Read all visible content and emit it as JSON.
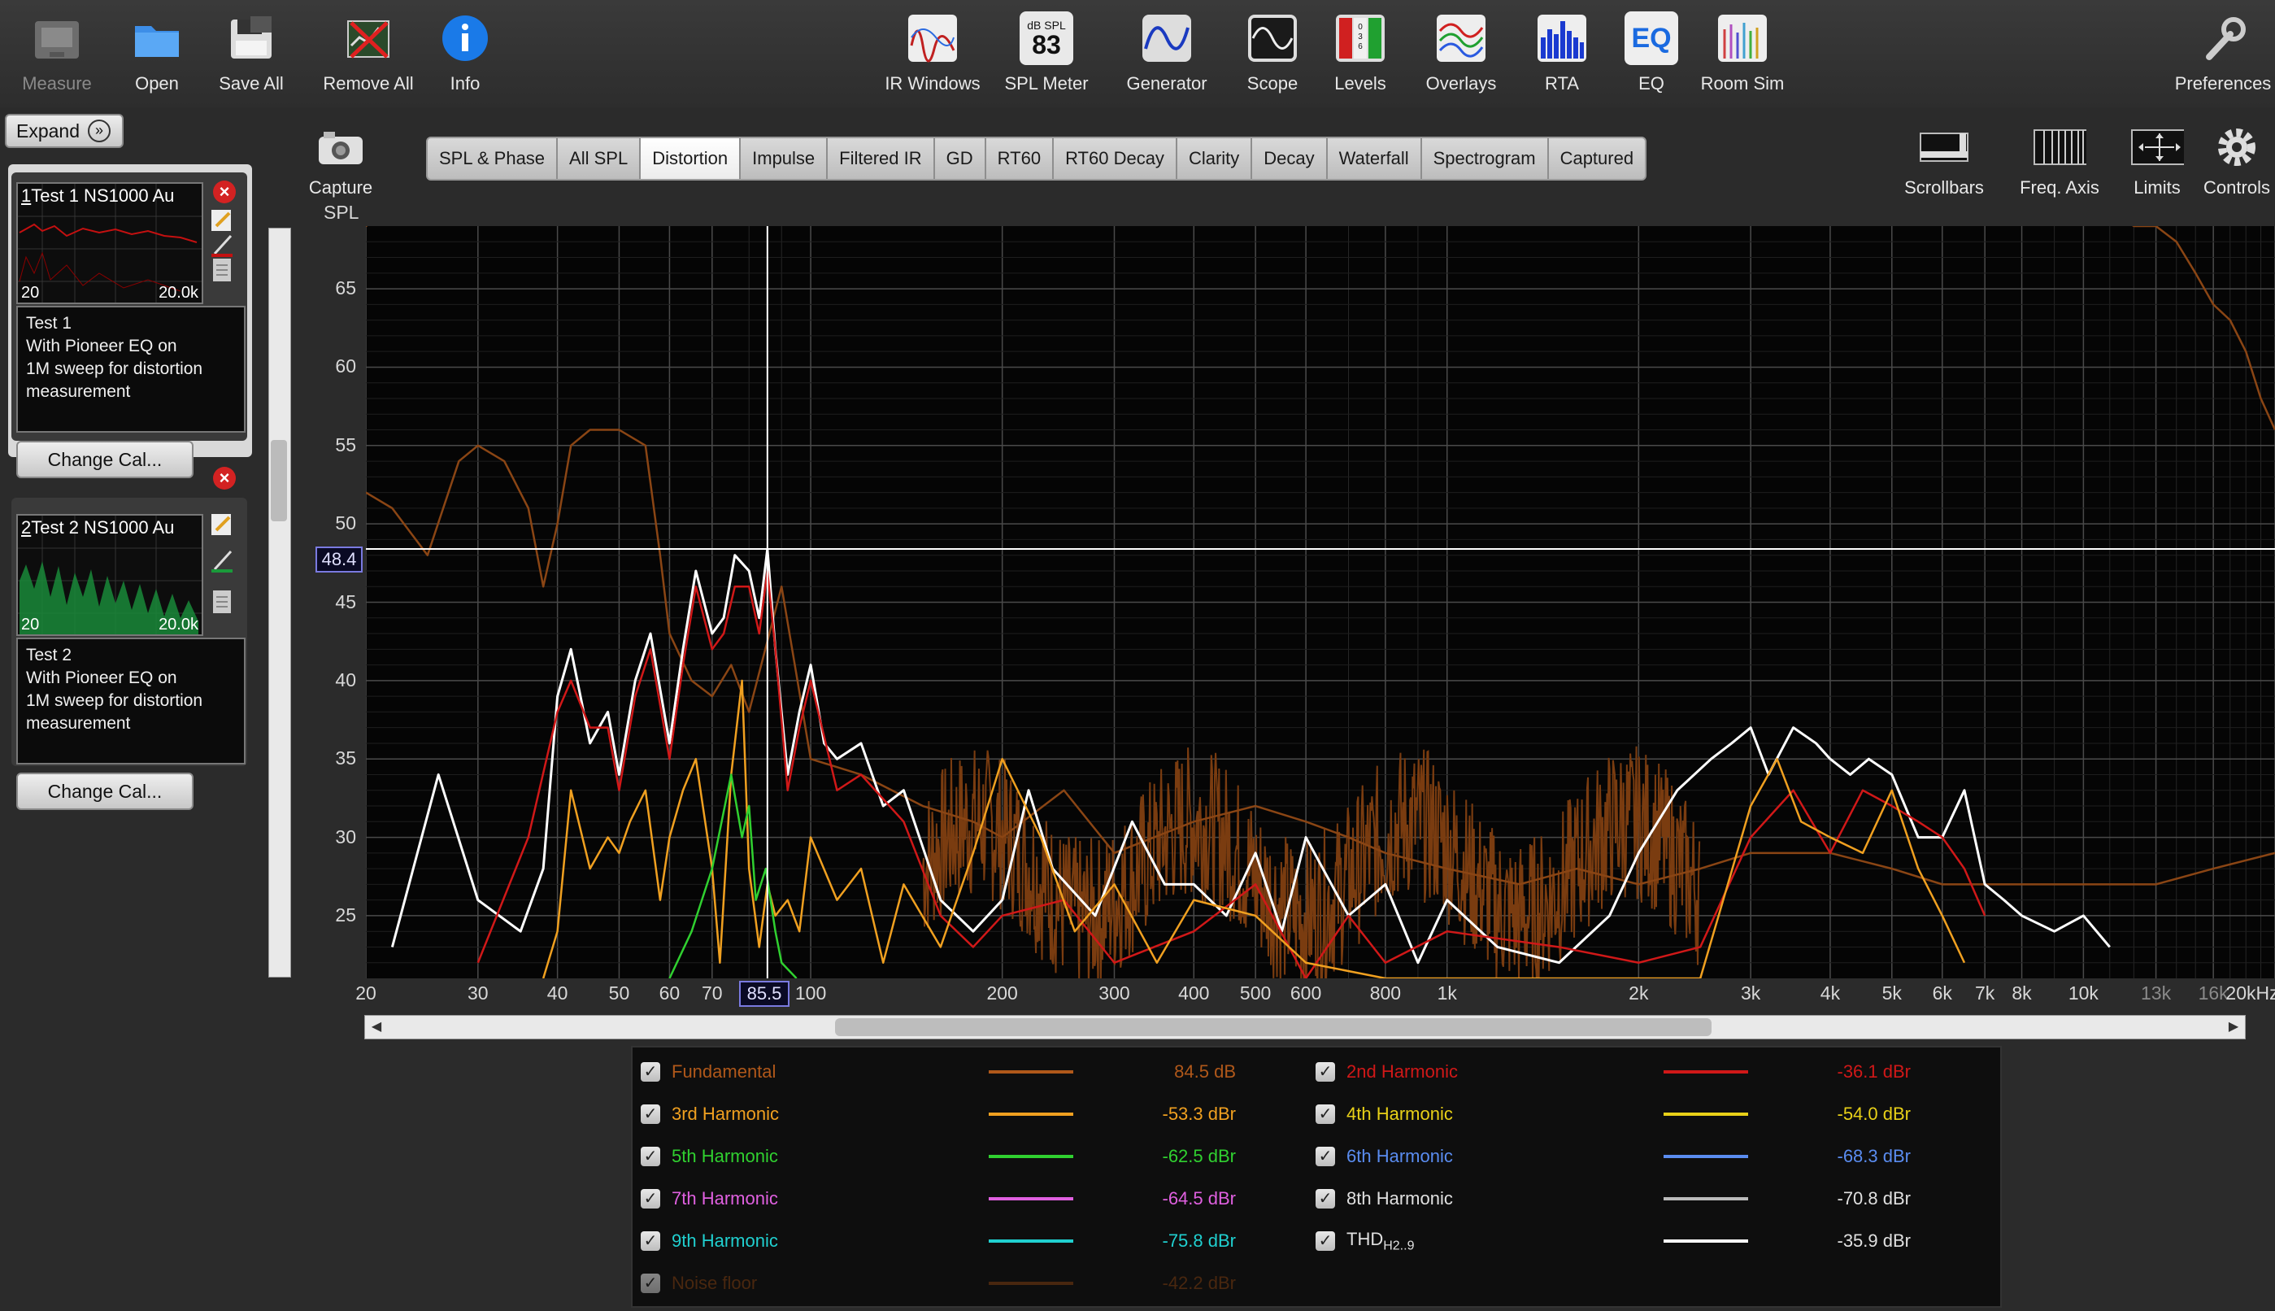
{
  "toolbar": {
    "left": [
      {
        "key": "measure",
        "label": "Measure",
        "disabled": true
      },
      {
        "key": "open",
        "label": "Open"
      },
      {
        "key": "save_all",
        "label": "Save All"
      },
      {
        "key": "remove_all",
        "label": "Remove All"
      },
      {
        "key": "info",
        "label": "Info"
      }
    ],
    "center": [
      {
        "key": "ir_windows",
        "label": "IR Windows"
      },
      {
        "key": "spl_meter",
        "label": "SPL Meter",
        "badge_top": "dB SPL",
        "badge_value": "83"
      },
      {
        "key": "generator",
        "label": "Generator"
      },
      {
        "key": "scope",
        "label": "Scope"
      },
      {
        "key": "levels",
        "label": "Levels",
        "badge_value": "0 3 6 9"
      },
      {
        "key": "overlays",
        "label": "Overlays"
      },
      {
        "key": "rta",
        "label": "RTA"
      },
      {
        "key": "eq",
        "label": "EQ",
        "badge_value": "EQ"
      },
      {
        "key": "room_sim",
        "label": "Room Sim"
      }
    ],
    "right_label": "Preferences"
  },
  "capture": {
    "label": "Capture"
  },
  "tabs": [
    "SPL & Phase",
    "All SPL",
    "Distortion",
    "Impulse",
    "Filtered IR",
    "GD",
    "RT60",
    "RT60 Decay",
    "Clarity",
    "Decay",
    "Waterfall",
    "Spectrogram",
    "Captured"
  ],
  "active_tab": "Distortion",
  "graph_controls": [
    "Scrollbars",
    "Freq. Axis",
    "Limits",
    "Controls"
  ],
  "left_panel": {
    "expand_label": "Expand",
    "measurements": [
      {
        "index": "1",
        "name": "Test 1 NS1000 Au",
        "lo": "20",
        "hi": "20.0k",
        "notes": [
          "Test 1",
          "With Pioneer EQ on",
          "1M sweep for distortion",
          "measurement"
        ],
        "change_cal": "Change Cal...",
        "color": "#c41010"
      },
      {
        "index": "2",
        "name": "Test 2 NS1000 Au",
        "lo": "20",
        "hi": "20.0k",
        "notes": [
          "Test 2",
          "With Pioneer EQ on",
          "1M sweep for distortion",
          "measurement"
        ],
        "change_cal": "Change Cal...",
        "color": "#1a9a3a"
      }
    ]
  },
  "axis": {
    "y_title": "SPL",
    "y_ticks": [
      "65",
      "60",
      "55",
      "50",
      "45",
      "40",
      "35",
      "30",
      "25"
    ],
    "x_ticks": [
      {
        "label": "20",
        "f": 20
      },
      {
        "label": "30",
        "f": 30
      },
      {
        "label": "40",
        "f": 40
      },
      {
        "label": "50",
        "f": 50
      },
      {
        "label": "60",
        "f": 60
      },
      {
        "label": "70",
        "f": 70
      },
      {
        "label": "100",
        "f": 100
      },
      {
        "label": "200",
        "f": 200
      },
      {
        "label": "300",
        "f": 300
      },
      {
        "label": "400",
        "f": 400
      },
      {
        "label": "500",
        "f": 500
      },
      {
        "label": "600",
        "f": 600
      },
      {
        "label": "800",
        "f": 800
      },
      {
        "label": "1k",
        "f": 1000
      },
      {
        "label": "2k",
        "f": 2000
      },
      {
        "label": "3k",
        "f": 3000
      },
      {
        "label": "4k",
        "f": 4000
      },
      {
        "label": "5k",
        "f": 5000
      },
      {
        "label": "6k",
        "f": 6000
      },
      {
        "label": "7k",
        "f": 7000
      },
      {
        "label": "8k",
        "f": 8000
      },
      {
        "label": "10k",
        "f": 10000
      },
      {
        "label": "13k",
        "f": 13000,
        "dim": true
      },
      {
        "label": "16k",
        "f": 16000,
        "dim": true
      },
      {
        "label": "20kHz",
        "f": 20000
      }
    ],
    "cursor_freq": "85.5",
    "cursor_spl": "48.4"
  },
  "legend": {
    "left": [
      {
        "name": "Fundamental",
        "value": "84.5 dB",
        "color": "#b0581a"
      },
      {
        "name": "3rd Harmonic",
        "value": "-53.3 dBr",
        "color": "#f0a020"
      },
      {
        "name": "5th Harmonic",
        "value": "-62.5 dBr",
        "color": "#30d030"
      },
      {
        "name": "7th Harmonic",
        "value": "-64.5 dBr",
        "color": "#e060e0"
      },
      {
        "name": "9th Harmonic",
        "value": "-75.8 dBr",
        "color": "#20d0d0"
      },
      {
        "name": "Noise floor",
        "value": "-42.2 dBr",
        "color": "#7a3c10"
      }
    ],
    "right": [
      {
        "name": "2nd Harmonic",
        "value": "-36.1 dBr",
        "color": "#d01818"
      },
      {
        "name": "4th Harmonic",
        "value": "-54.0 dBr",
        "color": "#e8d018"
      },
      {
        "name": "6th Harmonic",
        "value": "-68.3 dBr",
        "color": "#5a8cf0"
      },
      {
        "name": "8th Harmonic",
        "value": "-70.8 dBr",
        "color": "#bbbbbb"
      },
      {
        "name": "THD",
        "sub": "H2..9",
        "value": "-35.9 dBr",
        "color": "#ffffff"
      }
    ]
  },
  "chart_data": {
    "type": "line",
    "x_scale": "log",
    "xlim": [
      20,
      20000
    ],
    "ylim": [
      21,
      69
    ],
    "ylabel": "SPL",
    "series": [
      {
        "name": "Fundamental",
        "color": "#8a4514",
        "x": [
          20,
          22,
          24,
          27,
          30,
          33,
          36,
          40,
          44,
          48,
          52,
          55,
          58,
          62,
          66,
          70,
          75,
          80,
          85,
          90,
          100,
          110,
          120,
          140,
          160,
          180,
          200,
          250,
          300,
          350,
          400,
          500,
          600,
          700,
          800,
          1000,
          1500,
          2000,
          2500,
          3000,
          4000,
          5000,
          6000,
          7000,
          8000,
          9000,
          10000,
          11000,
          12000,
          13000,
          14000,
          15000,
          16000,
          17000,
          18000,
          19000,
          20000
        ],
        "y": [
          69,
          70,
          70,
          70,
          70,
          70,
          70,
          70,
          70,
          70,
          70,
          70,
          70,
          70,
          70,
          70,
          70,
          70,
          70,
          70,
          70,
          70,
          70,
          70,
          70,
          70,
          70,
          70,
          70,
          70,
          70,
          70,
          70,
          70,
          70,
          70,
          70,
          70,
          70,
          70,
          70,
          70,
          70,
          70,
          70,
          70,
          70,
          70,
          69,
          69,
          68,
          66,
          64,
          63,
          61,
          58,
          56
        ]
      },
      {
        "name": "Noise floor",
        "color": "#8a4514",
        "x": [
          20,
          22,
          25,
          28,
          30,
          33,
          36,
          38,
          40,
          42,
          45,
          50,
          55,
          58,
          60,
          65,
          70,
          75,
          80,
          90,
          100,
          120,
          150,
          180,
          200,
          250,
          300,
          400,
          500,
          600,
          700,
          800,
          1000,
          1300,
          1600,
          2000,
          2500,
          3000,
          4000,
          5000,
          6000,
          8000,
          10000,
          13000,
          16000,
          20000
        ],
        "y": [
          52,
          51,
          48,
          54,
          55,
          54,
          51,
          46,
          50,
          55,
          56,
          56,
          55,
          48,
          43,
          40,
          39,
          41,
          38,
          46,
          35,
          34,
          32,
          31,
          30,
          33,
          29,
          31,
          32,
          31,
          30,
          29,
          28,
          27,
          28,
          27,
          28,
          29,
          29,
          28,
          27,
          27,
          27,
          27,
          28,
          29
        ]
      },
      {
        "name": "THD H2..9",
        "color": "#ffffff",
        "x": [
          22,
          26,
          30,
          35,
          38,
          40,
          42,
          45,
          48,
          50,
          53,
          56,
          60,
          63,
          66,
          70,
          73,
          76,
          80,
          83,
          85.5,
          88,
          92,
          96,
          100,
          105,
          110,
          120,
          130,
          140,
          160,
          180,
          200,
          220,
          240,
          280,
          320,
          360,
          400,
          450,
          500,
          550,
          600,
          700,
          800,
          900,
          1000,
          1200,
          1500,
          1800,
          2000,
          2300,
          2600,
          2800,
          3000,
          3200,
          3500,
          3800,
          4000,
          4300,
          4600,
          5000,
          5500,
          6000,
          6500,
          7000,
          7500,
          8000,
          9000,
          10000,
          11000
        ],
        "y": [
          23,
          34,
          26,
          24,
          28,
          39,
          42,
          36,
          38,
          34,
          40,
          43,
          36,
          42,
          47,
          43,
          44,
          48,
          47,
          44,
          48.4,
          42,
          34,
          38,
          41,
          36,
          35,
          36,
          32,
          33,
          26,
          24,
          26,
          33,
          28,
          25,
          31,
          27,
          27,
          25,
          29,
          24,
          30,
          25,
          27,
          22,
          26,
          23,
          22,
          25,
          29,
          33,
          35,
          36,
          37,
          34,
          37,
          36,
          35,
          34,
          35,
          34,
          30,
          30,
          33,
          27,
          26,
          25,
          24,
          25,
          23
        ]
      },
      {
        "name": "2nd Harmonic",
        "color": "#d01818",
        "x": [
          30,
          36,
          40,
          42,
          45,
          48,
          50,
          53,
          56,
          60,
          63,
          66,
          70,
          73,
          76,
          80,
          83,
          85.5,
          88,
          92,
          96,
          100,
          110,
          120,
          140,
          160,
          180,
          200,
          250,
          300,
          400,
          500,
          600,
          700,
          800,
          1000,
          1500,
          2000,
          2500,
          3000,
          3500,
          4000,
          4500,
          5000,
          5500,
          6000,
          6500,
          7000
        ],
        "y": [
          22,
          30,
          38,
          40,
          37,
          37,
          33,
          39,
          42,
          35,
          41,
          46,
          42,
          43,
          46,
          46,
          43,
          47,
          42,
          33,
          37,
          40,
          33,
          34,
          31,
          25,
          23,
          25,
          26,
          22,
          24,
          27,
          21,
          25,
          22,
          24,
          23,
          22,
          23,
          30,
          33,
          29,
          33,
          32,
          31,
          30,
          28,
          25
        ]
      },
      {
        "name": "3rd Harmonic",
        "color": "#f0a020",
        "x": [
          38,
          40,
          42,
          45,
          48,
          50,
          52,
          55,
          58,
          60,
          63,
          66,
          70,
          72,
          75,
          78,
          80,
          83,
          85.5,
          88,
          92,
          96,
          100,
          110,
          120,
          130,
          140,
          160,
          180,
          200,
          230,
          260,
          300,
          350,
          400,
          500,
          600,
          800,
          1000,
          2500,
          3000,
          3300,
          3600,
          4000,
          4500,
          5000,
          5500,
          6000,
          6500
        ],
        "y": [
          21,
          24,
          33,
          28,
          30,
          29,
          31,
          33,
          26,
          30,
          33,
          35,
          28,
          22,
          34,
          40,
          28,
          23,
          27,
          25,
          26,
          24,
          30,
          26,
          28,
          22,
          27,
          23,
          29,
          35,
          30,
          24,
          27,
          22,
          26,
          25,
          22,
          21,
          21,
          21,
          32,
          35,
          31,
          30,
          29,
          33,
          28,
          25,
          22
        ]
      },
      {
        "name": "5th Harmonic",
        "color": "#30d030",
        "x": [
          60,
          65,
          70,
          75,
          78,
          80,
          82,
          85,
          88,
          90,
          95
        ],
        "y": [
          21,
          24,
          28,
          34,
          30,
          32,
          26,
          28,
          24,
          22,
          21
        ]
      }
    ]
  }
}
